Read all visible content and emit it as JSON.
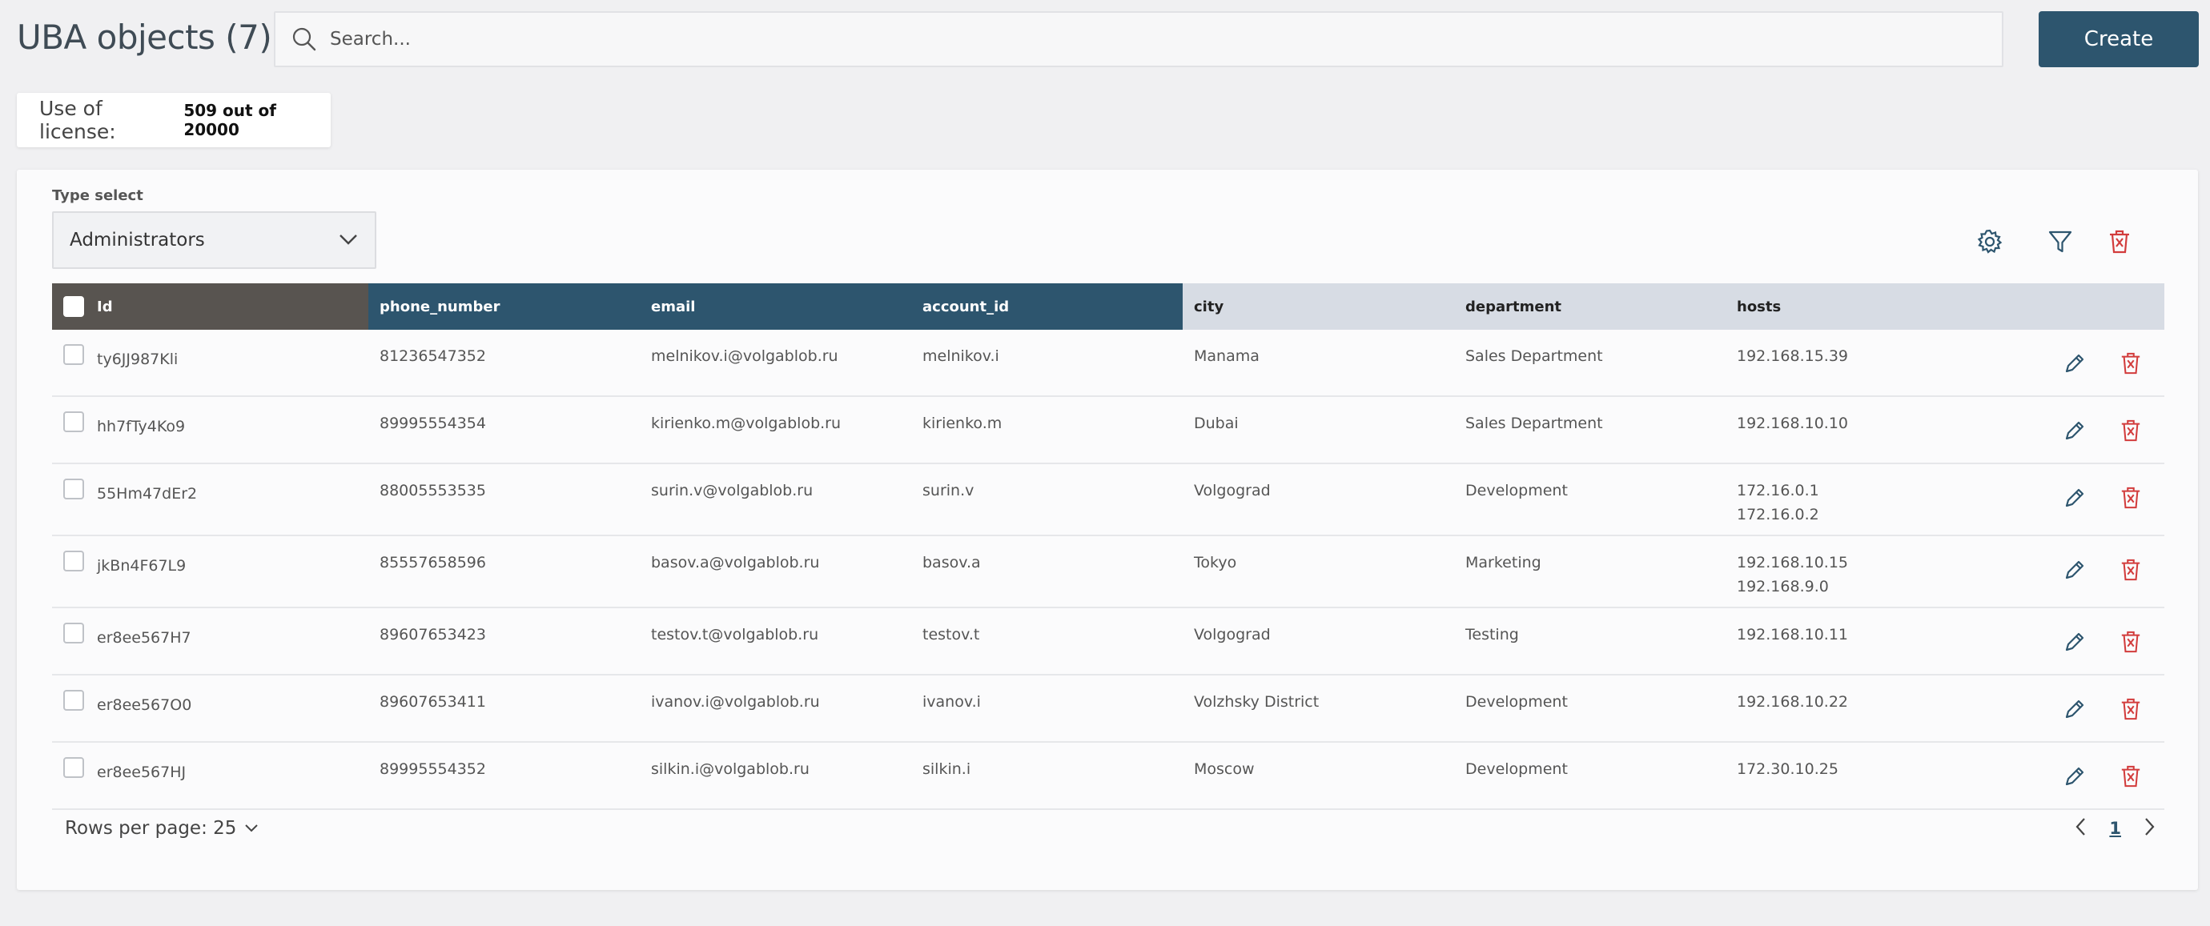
{
  "header": {
    "title": "UBA objects (7)",
    "search_placeholder": "Search...",
    "create_label": "Create"
  },
  "license": {
    "label": "Use of license:",
    "value": "509 out of 20000"
  },
  "filters": {
    "type_label": "Type select",
    "type_value": "Administrators"
  },
  "colors": {
    "accent": "#2d556e",
    "danger": "#d23c3c",
    "selected_header": "#585450",
    "light_header": "#d7dce4"
  },
  "table": {
    "columns": [
      "Id",
      "phone_number",
      "email",
      "account_id",
      "city",
      "department",
      "hosts"
    ],
    "rows": [
      {
        "id": "ty6JJ987Kli",
        "phone": "81236547352",
        "email": "melnikov.i@volgablob.ru",
        "account": "melnikov.i",
        "city": "Manama",
        "department": "Sales Department",
        "hosts": [
          "192.168.15.39"
        ]
      },
      {
        "id": "hh7fTy4Ko9",
        "phone": "89995554354",
        "email": "kirienko.m@volgablob.ru",
        "account": "kirienko.m",
        "city": "Dubai",
        "department": "Sales Department",
        "hosts": [
          "192.168.10.10"
        ]
      },
      {
        "id": "55Hm47dEr2",
        "phone": "88005553535",
        "email": "surin.v@volgablob.ru",
        "account": "surin.v",
        "city": "Volgograd",
        "department": "Development",
        "hosts": [
          "172.16.0.1",
          "172.16.0.2"
        ]
      },
      {
        "id": "jkBn4F67L9",
        "phone": "85557658596",
        "email": "basov.a@volgablob.ru",
        "account": "basov.a",
        "city": "Tokyo",
        "department": "Marketing",
        "hosts": [
          "192.168.10.15",
          "192.168.9.0"
        ]
      },
      {
        "id": "er8ee567H7",
        "phone": "89607653423",
        "email": "testov.t@volgablob.ru",
        "account": "testov.t",
        "city": "Volgograd",
        "department": "Testing",
        "hosts": [
          "192.168.10.11"
        ]
      },
      {
        "id": "er8ee567O0",
        "phone": "89607653411",
        "email": "ivanov.i@volgablob.ru",
        "account": "ivanov.i",
        "city": "Volzhsky District",
        "department": "Development",
        "hosts": [
          "192.168.10.22"
        ]
      },
      {
        "id": "er8ee567HJ",
        "phone": "89995554352",
        "email": "silkin.i@volgablob.ru",
        "account": "silkin.i",
        "city": "Moscow",
        "department": "Development",
        "hosts": [
          "172.30.10.25"
        ]
      }
    ]
  },
  "pagination": {
    "rows_per_page": "Rows per page: 25",
    "current_page": "1"
  },
  "icons": {
    "search": "search-icon",
    "settings": "gear-icon",
    "filter": "filter-icon",
    "delete": "trash-icon",
    "edit": "pencil-icon",
    "chevron": "chevron-down-icon",
    "prev": "chevron-left-icon",
    "next": "chevron-right-icon"
  }
}
